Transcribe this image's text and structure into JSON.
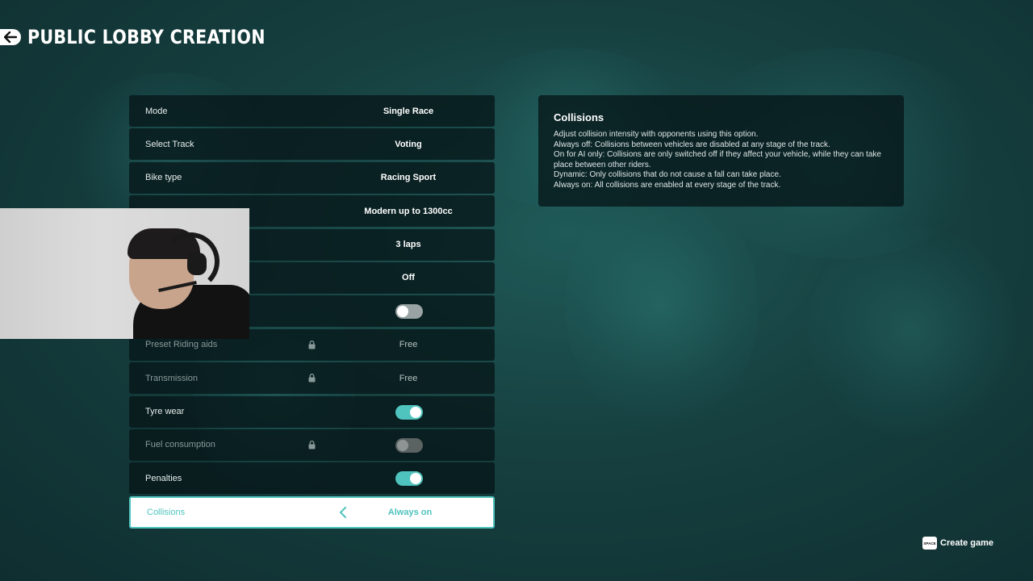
{
  "header": {
    "title": "PUBLIC LOBBY CREATION"
  },
  "settings": [
    {
      "label": "Mode",
      "value": "Single Race",
      "type": "value",
      "disabled": false
    },
    {
      "label": "Select Track",
      "value": "Voting",
      "type": "value",
      "disabled": false
    },
    {
      "label": "Bike type",
      "value": "Racing Sport",
      "type": "value",
      "disabled": false
    },
    {
      "label": "",
      "value": "Modern up to 1300cc",
      "type": "value",
      "disabled": false
    },
    {
      "label": "",
      "value": "3 laps",
      "type": "value",
      "disabled": false
    },
    {
      "label": "",
      "value": "Off",
      "type": "value",
      "disabled": false
    },
    {
      "label": "",
      "value": "",
      "type": "toggle",
      "state": "off",
      "disabled": false
    },
    {
      "label": "Preset Riding aids",
      "value": "Free",
      "type": "value",
      "disabled": true,
      "locked": true
    },
    {
      "label": "Transmission",
      "value": "Free",
      "type": "value",
      "disabled": true,
      "locked": true
    },
    {
      "label": "Tyre wear",
      "value": "",
      "type": "toggle",
      "state": "on",
      "disabled": false
    },
    {
      "label": "Fuel consumption",
      "value": "",
      "type": "toggle",
      "state": "off",
      "disabled": true,
      "locked": true
    },
    {
      "label": "Penalties",
      "value": "",
      "type": "toggle",
      "state": "on",
      "disabled": false
    },
    {
      "label": "Collisions",
      "value": "Always on",
      "type": "selector",
      "disabled": false,
      "selected": true
    }
  ],
  "info": {
    "title": "Collisions",
    "lines": [
      "Adjust collision intensity with opponents using this option.",
      "Always off: Collisions between vehicles are disabled at any stage of the track.",
      "On for AI only: Collisions are only switched off if they affect your vehicle, while they can take place between other riders.",
      "Dynamic: Only collisions that do not cause a fall can take place.",
      "Always on: All collisions are enabled at every stage of the track."
    ]
  },
  "footer": {
    "key_label": "SPACE",
    "create_label": "Create game"
  },
  "colors": {
    "accent": "#4fc3bd",
    "panel": "#061618"
  }
}
